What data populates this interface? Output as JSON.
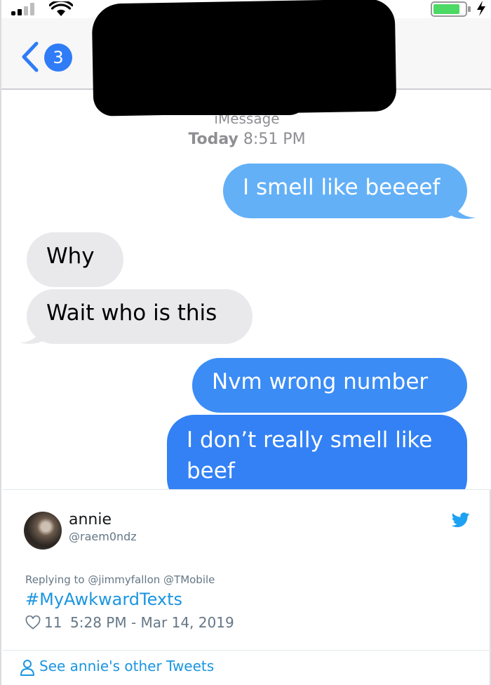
{
  "status_bar": {
    "signal_icon": "cellular-signal-icon",
    "wifi_icon": "wifi-icon",
    "battery_icon": "battery-icon",
    "charging_icon": "charging-bolt-icon",
    "battery_level": 0.85
  },
  "messages_header": {
    "back_icon": "chevron-left-icon",
    "unread_count": "3",
    "service_label": "iMessage",
    "timestamp_day": "Today",
    "timestamp_time": "8:51 PM"
  },
  "messages": [
    {
      "direction": "outgoing",
      "text": "I smell like beeeef"
    },
    {
      "direction": "incoming",
      "text": "Why"
    },
    {
      "direction": "incoming",
      "text": "Wait who is this"
    },
    {
      "direction": "outgoing",
      "text": "Nvm wrong number"
    },
    {
      "direction": "outgoing",
      "text": "I don’t really smell like beef"
    }
  ],
  "tweet": {
    "display_name": "annie",
    "handle": "@raem0ndz",
    "replying_to": "Replying to @jimmyfallon @TMobile",
    "hashtag": "#MyAwkwardTexts",
    "like_count": "11",
    "timestamp": "5:28 PM - Mar 14, 2019",
    "see_more": "See annie's other Tweets",
    "icons": {
      "logo": "twitter-bird-icon",
      "like": "heart-icon",
      "profile": "user-icon"
    }
  },
  "colors": {
    "imessage_blue": "#3381f4",
    "imessage_light_blue": "#63b0f7",
    "incoming_gray": "#e9e9eb",
    "twitter_blue": "#1b95e0",
    "badge_blue": "#2f7cf6"
  }
}
